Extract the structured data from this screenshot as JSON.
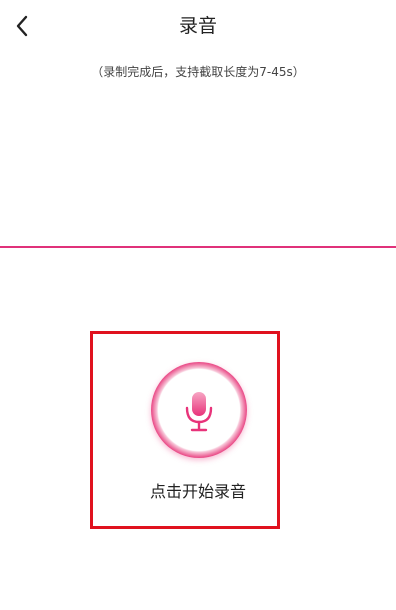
{
  "header": {
    "title": "录音",
    "back_icon": "chevron-left-icon"
  },
  "hint": "（录制完成后，支持截取长度为7-45s）",
  "record": {
    "label": "点击开始录音",
    "icon": "microphone-icon",
    "accent_color": "#e8337a"
  },
  "highlight_color": "#e0111e"
}
